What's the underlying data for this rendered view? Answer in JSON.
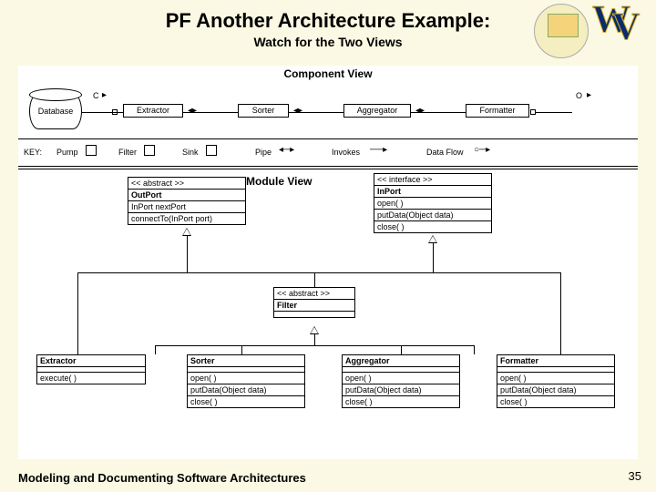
{
  "title": "PF Another Architecture Example:",
  "subtitle": "Watch for the Two Views",
  "footer": "Modeling and Documenting Software Architectures",
  "page": "35",
  "component_view": {
    "label": "Component View",
    "database": "Database",
    "c_marker": "C",
    "o_marker": "O",
    "nodes": {
      "extractor": "Extractor",
      "sorter": "Sorter",
      "aggregator": "Aggregator",
      "formatter": "Formatter"
    },
    "key": {
      "label": "KEY:",
      "pump": "Pump",
      "filter": "Filter",
      "sink": "Sink",
      "pipe": "Pipe",
      "invokes": "Invokes",
      "dataflow": "Data Flow"
    }
  },
  "module_view": {
    "label": "Module View",
    "outport": {
      "stereo": "<< abstract >>",
      "name": "OutPort",
      "m1": "InPort nextPort",
      "m2": "connectTo(InPort port)"
    },
    "inport": {
      "stereo": "<< interface >>",
      "name": "InPort",
      "m1": "open( )",
      "m2": "putData(Object data)",
      "m3": "close( )"
    },
    "filter": {
      "stereo": "<< abstract >>",
      "name": "Filter"
    },
    "extractor": {
      "name": "Extractor",
      "m1": "execute( )"
    },
    "sorter": {
      "name": "Sorter",
      "m1": "open( )",
      "m2": "putData(Object data)",
      "m3": "close( )"
    },
    "aggregator": {
      "name": "Aggregator",
      "m1": "open( )",
      "m2": "putData(Object data)",
      "m3": "close( )"
    },
    "formatter": {
      "name": "Formatter",
      "m1": "open( )",
      "m2": "putData(Object data)",
      "m3": "close( )"
    }
  }
}
